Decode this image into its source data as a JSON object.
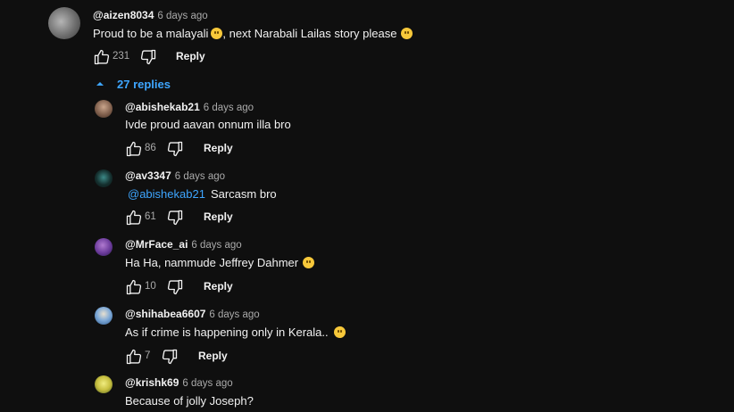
{
  "thread": {
    "top_comment": {
      "author": "@aizen8034",
      "time": "6 days ago",
      "text": "Proud to be a malayali",
      "text_after_emoji": ", next Narabali Lailas story please",
      "likes": "231",
      "reply_label": "Reply",
      "avatar_color": "#8b8b8b"
    },
    "replies_toggle": {
      "label": "27 replies",
      "icon": "chevron-up-icon"
    },
    "replies": [
      {
        "author": "@abishekab21",
        "time": "6 days ago",
        "text": "Ivde proud aavan onnum illa bro",
        "likes": "86",
        "reply_label": "Reply",
        "avatar_color": "#a08070"
      },
      {
        "author": "@av3347",
        "time": "6 days ago",
        "mention": "@abishekab21",
        "text": "Sarcasm bro",
        "likes": "61",
        "reply_label": "Reply",
        "avatar_color": "#1f3a3a"
      },
      {
        "author": "@MrFace_ai",
        "time": "6 days ago",
        "text": "Ha Ha, nammude Jeffrey Dahmer",
        "likes": "10",
        "reply_label": "Reply",
        "avatar_color": "#6a3a9a"
      },
      {
        "author": "@shihabea6607",
        "time": "6 days ago",
        "text": "As if crime is happening only in Kerala..",
        "likes": "7",
        "reply_label": "Reply",
        "avatar_color": "#5a8ac0"
      },
      {
        "author": "@krishk69",
        "time": "6 days ago",
        "text": "Because of jolly Joseph?",
        "avatar_color": "#c8c040"
      }
    ]
  },
  "colors": {
    "background": "#0f0f0f",
    "text": "#f1f1f1",
    "secondary": "#aaaaaa",
    "link": "#3ea6ff"
  }
}
